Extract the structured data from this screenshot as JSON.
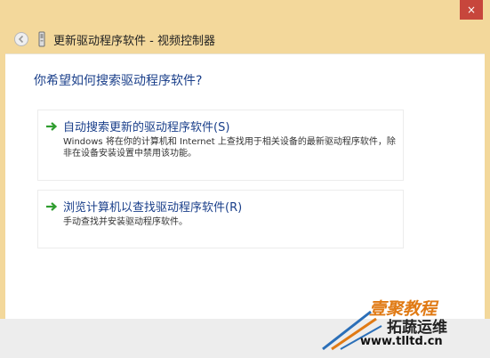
{
  "titlebar": {
    "close_label": "×"
  },
  "header": {
    "title": "更新驱动程序软件 - 视频控制器",
    "back_icon": "back-arrow-icon",
    "device_icon": "device-icon"
  },
  "main": {
    "question": "你希望如何搜索驱动程序软件?",
    "options": [
      {
        "title": "自动搜索更新的驱动程序软件(S)",
        "description": "Windows 将在你的计算机和 Internet 上查找用于相关设备的最新驱动程序软件，除非在设备安装设置中禁用该功能。",
        "icon": "green-arrow-icon"
      },
      {
        "title": "浏览计算机以查找驱动程序软件(R)",
        "description": "手动查找并安装驱动程序软件。",
        "icon": "green-arrow-icon"
      }
    ]
  },
  "watermark": {
    "line1": "壹聚教程",
    "line2": "拓蔬运维",
    "line3": "www.tlltd.cn"
  },
  "colors": {
    "header_bg": "#f3d89b",
    "link_blue": "#1a3f8a",
    "arrow_green": "#2f9d2f",
    "close_red": "#c7463c",
    "watermark_orange": "#e07a14"
  }
}
